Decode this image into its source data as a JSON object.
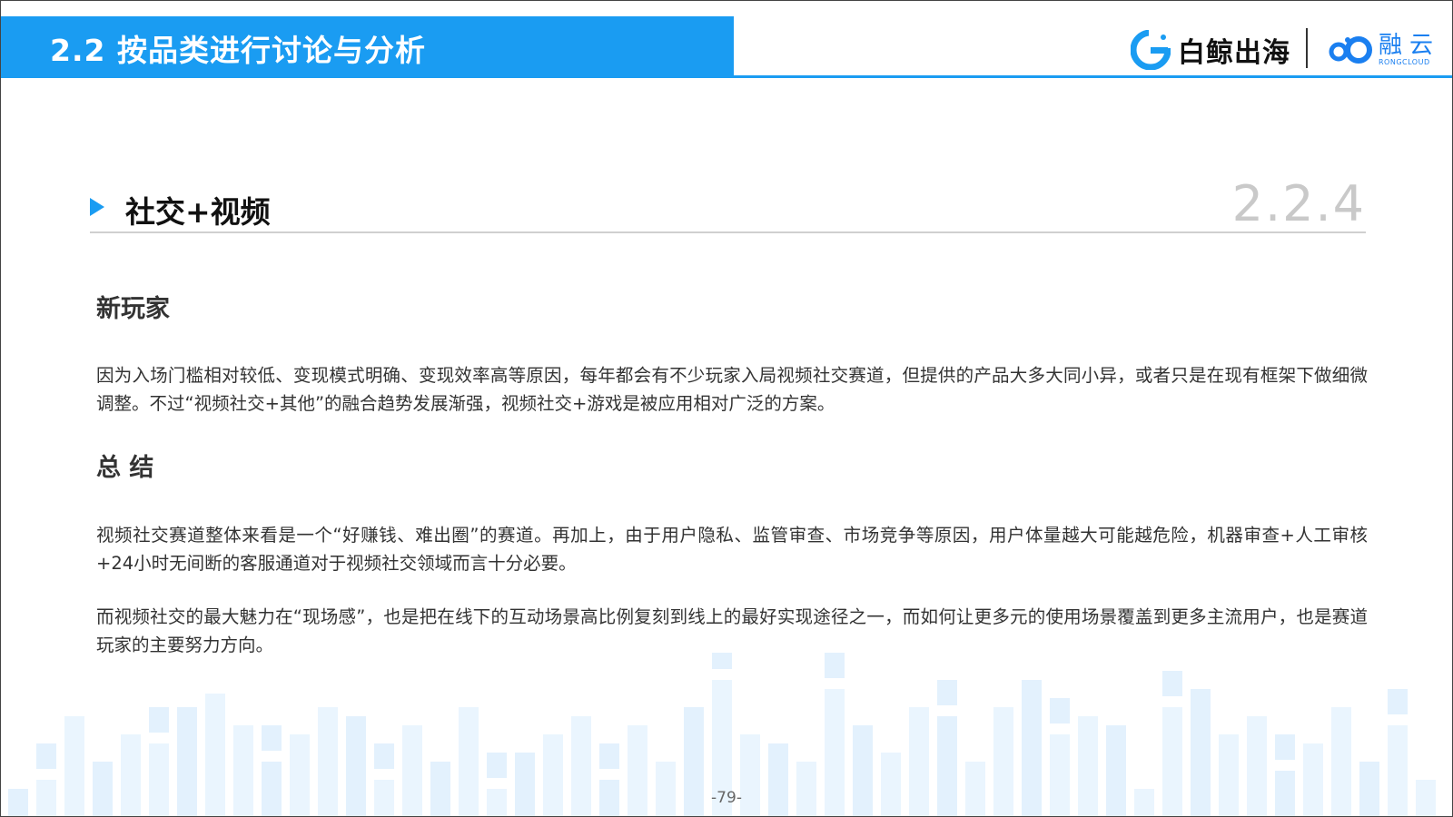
{
  "header": {
    "title": "2.2 按品类进行讨论与分析",
    "logo_baijing": "白鲸出海",
    "logo_rongcloud_cn": "融云",
    "logo_rongcloud_en": "RONGCLOUD",
    "accent_color": "#1a9cf2"
  },
  "section": {
    "title": "社交+视频",
    "number": "2.2.4"
  },
  "blocks": [
    {
      "heading": "新玩家",
      "paragraphs": [
        "因为入场门槛相对较低、变现模式明确、变现效率高等原因，每年都会有不少玩家入局视频社交赛道，但提供的产品大多大同小异，或者只是在现有框架下做细微调整。不过“视频社交+其他”的融合趋势发展渐强，视频社交+游戏是被应用相对广泛的方案。"
      ]
    },
    {
      "heading": "总 结",
      "paragraphs": [
        "视频社交赛道整体来看是一个“好赚钱、难出圈”的赛道。再加上，由于用户隐私、监管审查、市场竞争等原因，用户体量越大可能越危险，机器审查+人工审核+24小时无间断的客服通道对于视频社交领域而言十分必要。",
        "而视频社交的最大魅力在“现场感”，也是把在线下的互动场景高比例复刻到线上的最好实现途径之一，而如何让更多元的使用场景覆盖到更多主流用户，也是赛道玩家的主要努力方向。"
      ]
    }
  ],
  "page_number": "-79-"
}
